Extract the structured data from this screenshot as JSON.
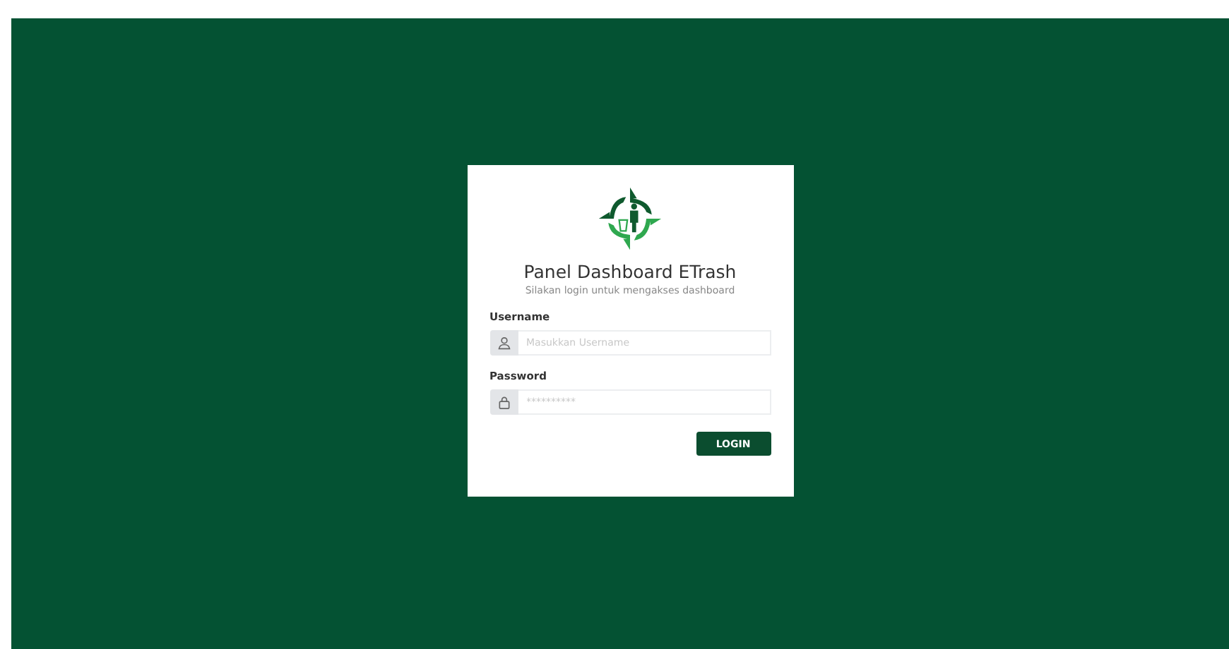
{
  "login_card": {
    "title": "Panel Dashboard ETrash",
    "subtitle": "Silakan login untuk mengakses dashboard",
    "fields": [
      {
        "kind": "text",
        "label": "Username",
        "placeholder": "Masukkan Username"
      },
      {
        "kind": "password",
        "label": "Password",
        "placeholder": "**********"
      }
    ],
    "button": "LOGIN"
  }
}
